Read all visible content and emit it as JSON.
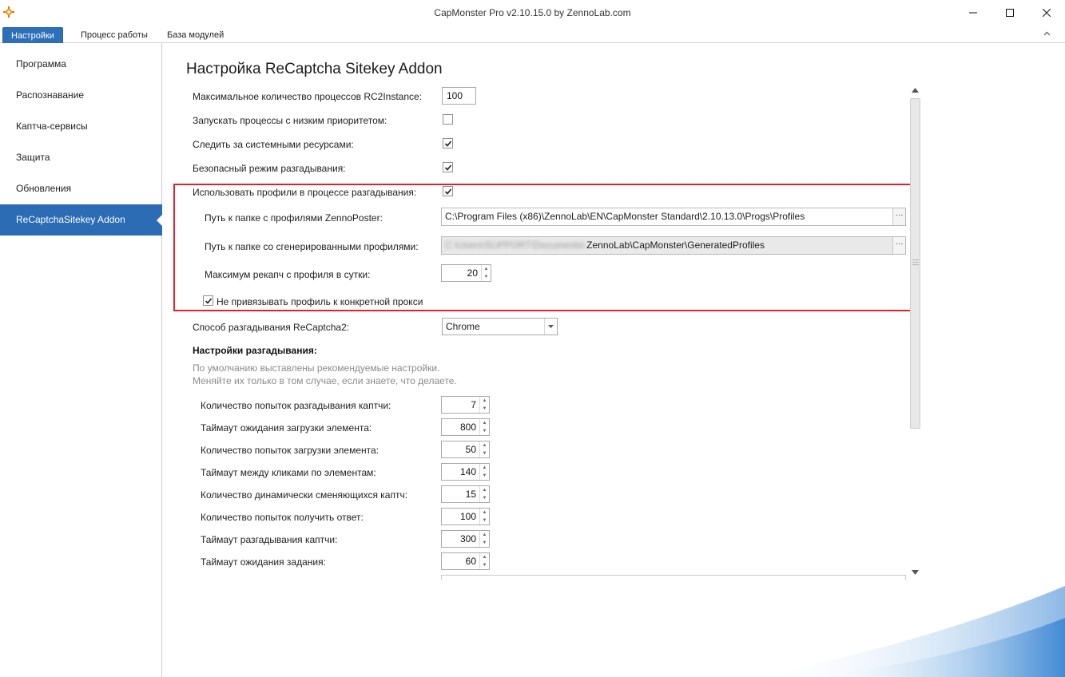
{
  "window": {
    "title": "CapMonster Pro v2.10.15.0 by ZennoLab.com"
  },
  "tabs": [
    {
      "label": "Настройки",
      "active": true
    },
    {
      "label": "Процесс работы",
      "active": false
    },
    {
      "label": "База модулей",
      "active": false
    }
  ],
  "sidebar": {
    "items": [
      {
        "label": "Программа"
      },
      {
        "label": "Распознавание"
      },
      {
        "label": "Каптча-сервисы"
      },
      {
        "label": "Защита"
      },
      {
        "label": "Обновления"
      },
      {
        "label": "ReCaptchaSitekey Addon",
        "active": true
      }
    ]
  },
  "main": {
    "title": "Настройка ReCaptcha Sitekey Addon",
    "max_processes": {
      "label": "Максимальное количество процессов RC2Instance:",
      "value": "100"
    },
    "low_priority": {
      "label": "Запускать процессы с низким приоритетом:",
      "checked": false
    },
    "monitor_resources": {
      "label": "Следить за системными ресурсами:",
      "checked": true
    },
    "safe_mode": {
      "label": "Безопасный режим разгадывания:",
      "checked": true
    },
    "use_profiles": {
      "label": "Использовать профили в процессе разгадывания:",
      "checked": true
    },
    "profiles_path": {
      "label": "Путь к папке с профилями ZennoPoster:",
      "value": "C:\\Program Files (x86)\\ZennoLab\\EN\\CapMonster Standard\\2.10.13.0\\Progs\\Profiles"
    },
    "generated_path": {
      "label": "Путь к папке со сгенерированными профилями:",
      "blurred_prefix": "C:\\Users\\SUPPORT\\Documents\\",
      "value": "ZennoLab\\CapMonster\\GeneratedProfiles"
    },
    "max_recaptchas": {
      "label": "Максимум рекапч с профиля в сутки:",
      "value": "20"
    },
    "no_bind_proxy": {
      "label": "Не привязывать профиль к конкретной прокси",
      "checked": true
    },
    "solve_method": {
      "label": "Способ разгадывания ReCaptcha2:",
      "value": "Chrome"
    },
    "solve_settings": {
      "heading": "Настройки разгадывания:",
      "hint_line1": "По умолчанию выставлены рекомендуемые настройки.",
      "hint_line2": "Меняйте их только в том случае, если знаете, что делаете.",
      "rows": [
        {
          "label": "Количество попыток разгадывания каптчи:",
          "value": "7"
        },
        {
          "label": "Таймаут ожидания загрузки элемента:",
          "value": "800"
        },
        {
          "label": "Количество попыток загрузки элемента:",
          "value": "50"
        },
        {
          "label": "Таймаут между кликами по элементам:",
          "value": "140"
        },
        {
          "label": "Количество динамически сменяющихся каптч:",
          "value": "15"
        },
        {
          "label": "Количество попыток получить ответ:",
          "value": "100"
        },
        {
          "label": "Таймаут разгадывания каптчи:",
          "value": "300"
        },
        {
          "label": "Таймаут ожидания задания:",
          "value": "60"
        }
      ]
    }
  },
  "colors": {
    "accent": "#2b6cb4",
    "highlight_border": "#e0202a"
  }
}
